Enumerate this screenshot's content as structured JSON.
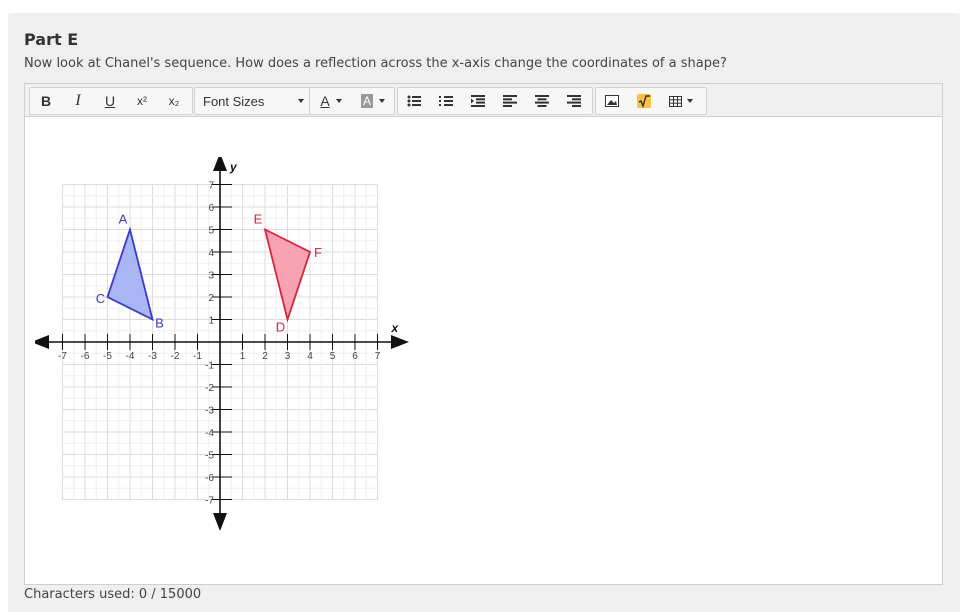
{
  "part_title": "Part E",
  "question": "Now look at Chanel's sequence. How does a reflection across the x-axis change the coordinates of a shape?",
  "toolbar": {
    "bold": "B",
    "italic": "I",
    "underline": "U",
    "superscript": "x²",
    "subscript": "x₂",
    "font_sizes": "Font Sizes",
    "text_color": "A",
    "bg_color": "A"
  },
  "graph": {
    "x_axis_label": "x",
    "y_axis_label": "y",
    "x_ticks": [
      "-7",
      "-6",
      "-5",
      "-4",
      "-3",
      "-2",
      "-1",
      "1",
      "2",
      "3",
      "4",
      "5",
      "6",
      "7"
    ],
    "y_ticks": [
      "7",
      "6",
      "5",
      "4",
      "3",
      "2",
      "1",
      "-1",
      "-2",
      "-3",
      "-4",
      "-5",
      "-6",
      "-7"
    ],
    "triangle_abc": {
      "color": "#3a3acc",
      "fill": "#a9b6f5",
      "vertices": [
        {
          "label": "A",
          "x": -4,
          "y": 5
        },
        {
          "label": "B",
          "x": -3,
          "y": 1
        },
        {
          "label": "C",
          "x": -5,
          "y": 2
        }
      ]
    },
    "triangle_def": {
      "color": "#d9263a",
      "fill": "#f7a3b4",
      "vertices": [
        {
          "label": "E",
          "x": 2,
          "y": 5
        },
        {
          "label": "F",
          "x": 4,
          "y": 4
        },
        {
          "label": "D",
          "x": 3,
          "y": 1
        }
      ]
    }
  },
  "footer": "Characters used: 0 / 15000"
}
